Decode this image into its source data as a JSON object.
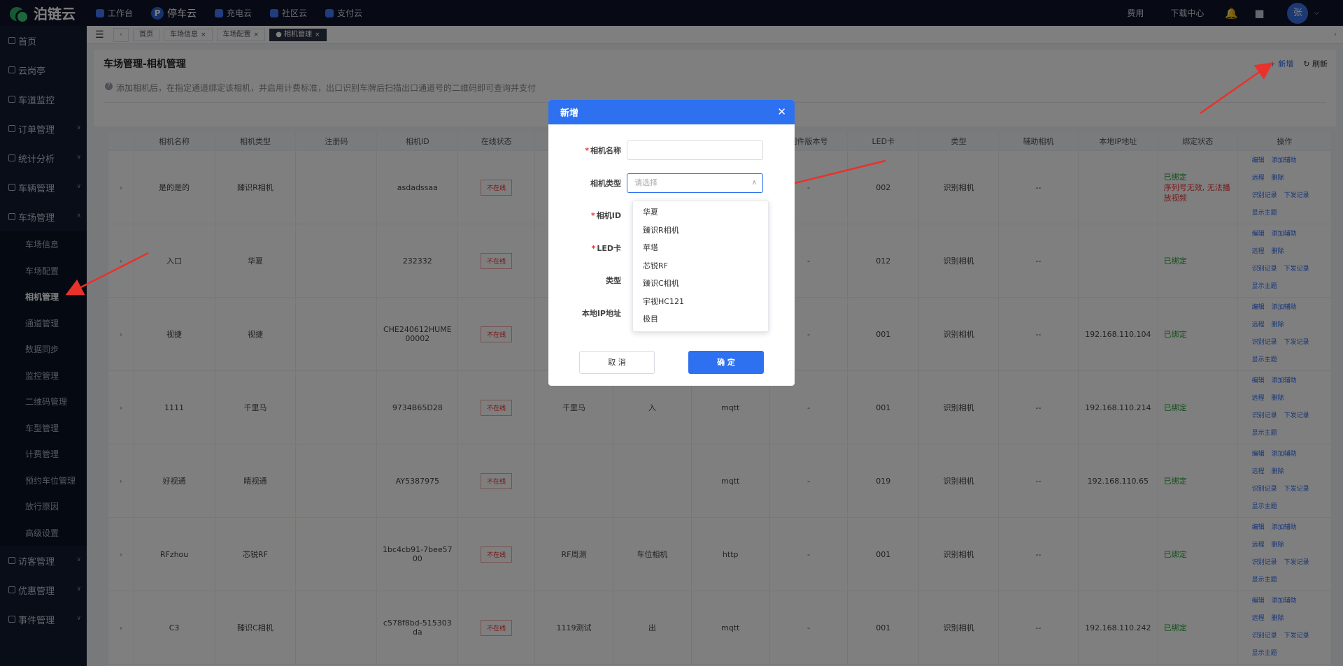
{
  "app": {
    "logo": "泊链云",
    "nav": [
      {
        "label": "工作台"
      },
      {
        "label": "停车云",
        "icon_text": "P"
      },
      {
        "label": "充电云"
      },
      {
        "label": "社区云"
      },
      {
        "label": "支付云"
      }
    ],
    "right_links": [
      "费用",
      "下载中心"
    ],
    "avatar": "张"
  },
  "sidebar": {
    "items_top": [
      {
        "label": "首页"
      },
      {
        "label": "云岗亭"
      },
      {
        "label": "车道监控"
      },
      {
        "label": "订单管理"
      },
      {
        "label": "统计分析"
      },
      {
        "label": "车辆管理"
      },
      {
        "label": "车场管理"
      }
    ],
    "sub_items": [
      {
        "label": "车场信息"
      },
      {
        "label": "车场配置"
      },
      {
        "label": "相机管理"
      },
      {
        "label": "通道管理"
      },
      {
        "label": "数据同步"
      },
      {
        "label": "监控管理"
      },
      {
        "label": "二维码管理"
      },
      {
        "label": "车型管理"
      },
      {
        "label": "计费管理"
      },
      {
        "label": "预约车位管理"
      },
      {
        "label": "放行原因"
      },
      {
        "label": "高级设置"
      }
    ],
    "items_bottom": [
      {
        "label": "访客管理"
      },
      {
        "label": "优惠管理"
      },
      {
        "label": "事件管理"
      }
    ]
  },
  "tabs": [
    {
      "label": "首页"
    },
    {
      "label": "车场信息"
    },
    {
      "label": "车场配置"
    },
    {
      "label": "相机管理"
    }
  ],
  "page": {
    "title": "车场管理-相机管理",
    "add_label": "+ 新增",
    "refresh_label": "刷新",
    "tip": "添加相机后，在指定通道绑定该相机，并启用计费标准，出口识别车牌后扫描出口通道号的二维码即可查询并支付"
  },
  "table": {
    "columns": [
      "",
      "相机名称",
      "相机类型",
      "注册码",
      "相机ID",
      "在线状态",
      "",
      "",
      "",
      "固件版本号",
      "LED卡",
      "类型",
      "辅助相机",
      "本地IP地址",
      "绑定状态",
      "操作"
    ],
    "rows": [
      {
        "name": "是的是的",
        "type": "臻识R相机",
        "reg": "",
        "id": "asdadssaa",
        "status": "不在线",
        "c6": "",
        "c7": "",
        "c8": "",
        "fw": "-",
        "led": "002",
        "kind": "识别相机",
        "aux": "--",
        "ip": "",
        "bind": "已绑定",
        "bind_warn": "序列号无效, 无法播放视频"
      },
      {
        "name": "入口",
        "type": "华夏",
        "reg": "",
        "id": "232332",
        "status": "不在线",
        "c6": "",
        "c7": "",
        "c8": "",
        "fw": "-",
        "led": "012",
        "kind": "识别相机",
        "aux": "--",
        "ip": "",
        "bind": "已绑定",
        "bind_warn": ""
      },
      {
        "name": "视捷",
        "type": "视捷",
        "reg": "",
        "id": "CHE240612HUME00002",
        "status": "不在线",
        "c6": "",
        "c7": "",
        "c8": "",
        "fw": "-",
        "led": "001",
        "kind": "识别相机",
        "aux": "--",
        "ip": "192.168.110.104",
        "bind": "已绑定",
        "bind_warn": ""
      },
      {
        "name": "1111",
        "type": "千里马",
        "reg": "",
        "id": "9734B65D28",
        "status": "不在线",
        "c6": "千里马",
        "c7": "入",
        "c8": "mqtt",
        "fw": "-",
        "led": "001",
        "kind": "识别相机",
        "aux": "--",
        "ip": "192.168.110.214",
        "bind": "已绑定",
        "bind_warn": ""
      },
      {
        "name": "好视通",
        "type": "睛视通",
        "reg": "",
        "id": "AY5387975",
        "status": "不在线",
        "c6": "",
        "c7": "",
        "c8": "mqtt",
        "fw": "-",
        "led": "019",
        "kind": "识别相机",
        "aux": "--",
        "ip": "192.168.110.65",
        "bind": "已绑定",
        "bind_warn": ""
      },
      {
        "name": "RFzhou",
        "type": "芯锐RF",
        "reg": "",
        "id": "1bc4cb91-7bee5700",
        "status": "不在线",
        "c6": "RF周测",
        "c7": "车位相机",
        "c8": "http",
        "fw": "-",
        "led": "001",
        "kind": "识别相机",
        "aux": "--",
        "ip": "",
        "bind": "已绑定",
        "bind_warn": ""
      },
      {
        "name": "C3",
        "type": "臻识C相机",
        "reg": "",
        "id": "c578f8bd-515303da",
        "status": "不在线",
        "c6": "1119测试",
        "c7": "出",
        "c8": "mqtt",
        "fw": "-",
        "led": "001",
        "kind": "识别相机",
        "aux": "--",
        "ip": "192.168.110.242",
        "bind": "已绑定",
        "bind_warn": ""
      }
    ],
    "ops": [
      "编辑",
      "添加辅助",
      "远程",
      "删除",
      "识别记录",
      "下发记录",
      "显示主题"
    ]
  },
  "modal": {
    "title": "新增",
    "fields": [
      {
        "label": "相机名称",
        "required": true,
        "value": "",
        "placeholder": ""
      },
      {
        "label": "相机类型",
        "required": false,
        "value": "",
        "placeholder": "请选择"
      },
      {
        "label": "相机ID",
        "required": true
      },
      {
        "label": "LED卡",
        "required": true
      },
      {
        "label": "类型",
        "required": false
      },
      {
        "label": "本地IP地址",
        "required": false
      }
    ],
    "dropdown_options": [
      "华夏",
      "臻识R相机",
      "苹塔",
      "芯锐RF",
      "臻识C相机",
      "宇视HC121",
      "极目"
    ],
    "cancel_label": "取 消",
    "ok_label": "确 定"
  },
  "colors": {
    "primary": "#2d70f0",
    "topbar_bg": "#0e1528",
    "sidebar_bg": "#111a2e",
    "offline_red": "#e22222",
    "bound_green": "#22a033",
    "annotation_arrow": "#e8322b"
  }
}
